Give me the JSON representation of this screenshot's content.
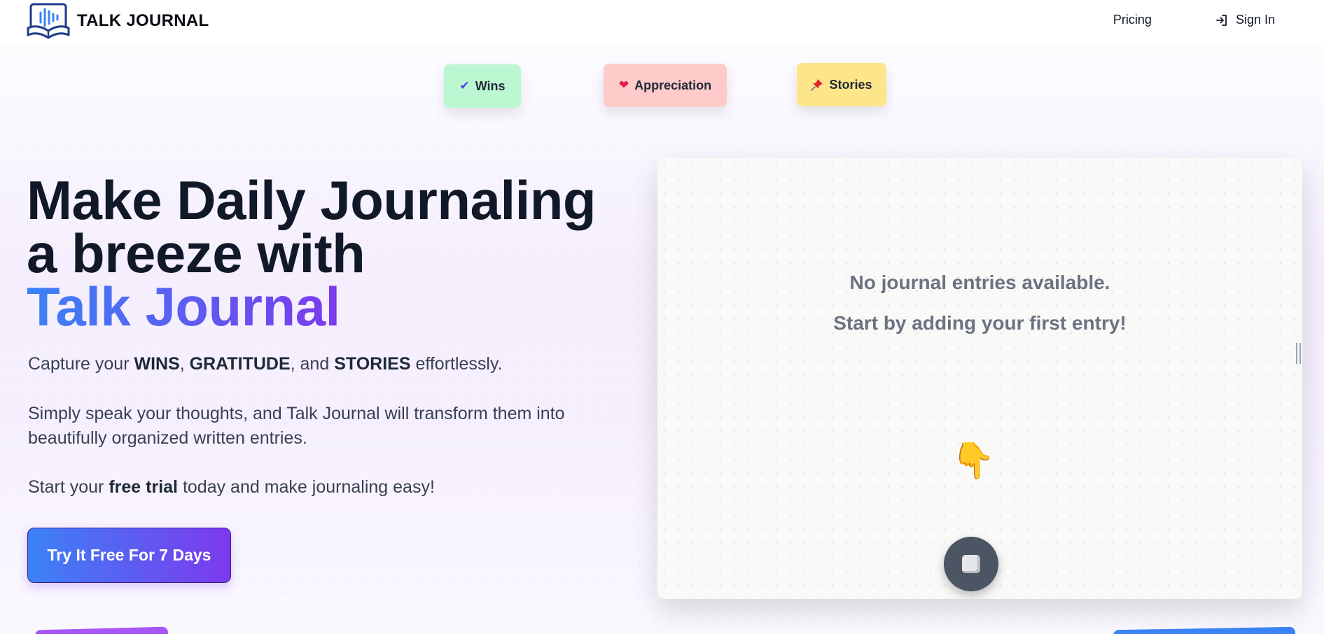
{
  "header": {
    "brand": "TALK JOURNAL",
    "logo_icon": "book-with-soundwave-icon",
    "nav": {
      "pricing": "Pricing",
      "sign_in": "Sign In",
      "sign_in_icon": "login-arrow-icon"
    }
  },
  "notes": [
    {
      "label": "Wins",
      "emoji": "✔",
      "color": "#bbf7d0"
    },
    {
      "label": "Appreciation",
      "emoji": "❤",
      "color": "#fecaca"
    },
    {
      "label": "Stories",
      "emoji": "📌",
      "color": "#fde68a"
    }
  ],
  "hero": {
    "title_line1": "Make Daily Journaling",
    "title_line2": "a breeze with",
    "title_brand": "Talk Journal",
    "p1": {
      "t1": "Capture your ",
      "b1": "WINS",
      "t2": ", ",
      "b2": "GRATITUDE",
      "t3": ", and ",
      "b3": "STORIES",
      "t4": " effortlessly."
    },
    "p2": "Simply speak your thoughts, and Talk Journal will transform them into beautifully organized written entries.",
    "p3": {
      "t1": "Start your ",
      "b1": "free trial",
      "t2": " today and make journaling easy!"
    },
    "cta": "Try It Free For 7 Days"
  },
  "journal": {
    "empty_line1": "No journal entries available.",
    "empty_line2": "Start by adding your first entry!",
    "pointer_emoji": "👇",
    "record_button_icon": "stop-square-icon"
  },
  "colors": {
    "accent_start": "#3b82f6",
    "accent_end": "#7c3aed",
    "text_dark": "#111827"
  }
}
